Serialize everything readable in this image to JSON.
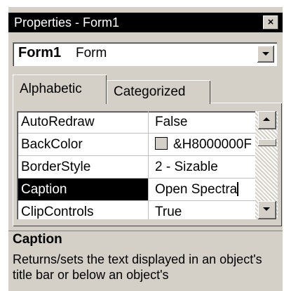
{
  "window": {
    "title": "Properties - Form1",
    "close_glyph": "×"
  },
  "object_selector": {
    "object_name": "Form1",
    "object_type": "Form"
  },
  "tabs": [
    {
      "label": "Alphabetic",
      "active": true
    },
    {
      "label": "Categorized",
      "active": false
    }
  ],
  "properties": [
    {
      "name": "AutoRedraw",
      "value": "False"
    },
    {
      "name": "BackColor",
      "value": "&H8000000F"
    },
    {
      "name": "BorderStyle",
      "value": "2 - Sizable"
    },
    {
      "name": "Caption",
      "value": "Open Spectra",
      "selected": true
    },
    {
      "name": "ClipControls",
      "value": "True"
    }
  ],
  "description": {
    "heading": "Caption",
    "text": "Returns/sets the text displayed in an object's title bar or below an object's"
  },
  "colors": {
    "face": "#d4d0c8",
    "title_bar": "#000000",
    "selection": "#000000",
    "window_bg": "#ffffff"
  }
}
